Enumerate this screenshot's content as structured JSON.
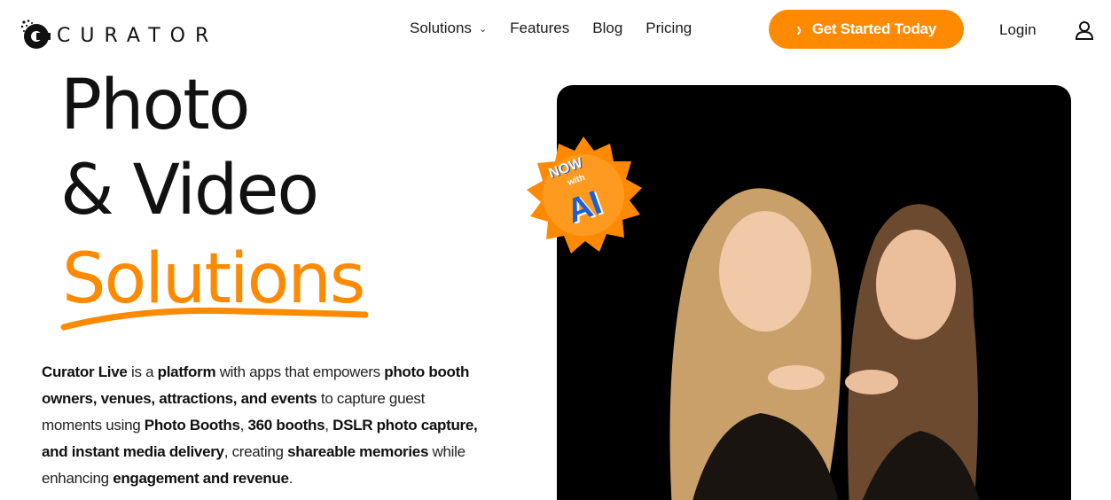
{
  "brand": {
    "name": "CURATOR"
  },
  "nav": {
    "solutions": "Solutions",
    "features": "Features",
    "blog": "Blog",
    "pricing": "Pricing"
  },
  "header": {
    "cta_label": "Get Started Today",
    "login_label": "Login"
  },
  "hero": {
    "line1": "Photo",
    "line2": "& Video",
    "line3": "Solutions",
    "description": [
      {
        "text": "Curator Live",
        "bold": true
      },
      {
        "text": " is a ",
        "bold": false
      },
      {
        "text": "platform",
        "bold": true
      },
      {
        "text": " with apps that empowers ",
        "bold": false
      },
      {
        "text": "photo booth owners, venues, attractions, and events",
        "bold": true
      },
      {
        "text": " to capture guest moments using ",
        "bold": false
      },
      {
        "text": "Photo Booths",
        "bold": true
      },
      {
        "text": ", ",
        "bold": false
      },
      {
        "text": "360 booths",
        "bold": true
      },
      {
        "text": ", ",
        "bold": false
      },
      {
        "text": "DSLR photo capture, and instant media delivery",
        "bold": true
      },
      {
        "text": ", creating ",
        "bold": false
      },
      {
        "text": "shareable memories",
        "bold": true
      },
      {
        "text": " while enhancing ",
        "bold": false
      },
      {
        "text": "engagement and revenue",
        "bold": true
      },
      {
        "text": ".",
        "bold": false
      }
    ]
  },
  "badge": {
    "now": "NOW",
    "with": "with",
    "ai": "AI"
  },
  "colors": {
    "accent": "#ff8a00",
    "badge_blue": "#1d5fd6",
    "image_bg": "#000000"
  },
  "icons": {
    "cta": "double-chevron-right-icon",
    "dropdown": "chevron-down-icon",
    "account": "user-icon"
  }
}
